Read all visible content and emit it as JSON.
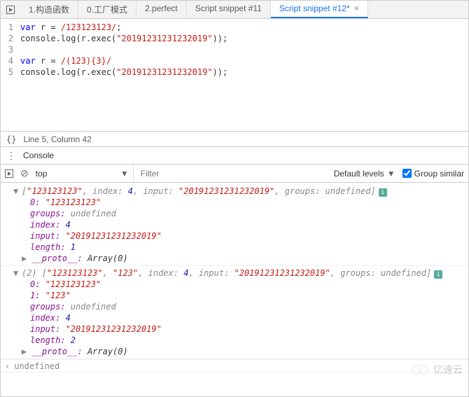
{
  "tabs": {
    "items": [
      "1.构造函数",
      "0.工厂模式",
      "2.perfect",
      "Script snippet #11",
      "Script snippet #12*"
    ],
    "active_index": 4,
    "close_glyph": "×"
  },
  "code": {
    "lines": [
      {
        "n": "1",
        "tokens": [
          {
            "t": "var ",
            "c": "kw"
          },
          {
            "t": "r = ",
            "c": "punc"
          },
          {
            "t": "/123123123/",
            "c": "regex"
          },
          {
            "t": ";",
            "c": "punc"
          }
        ]
      },
      {
        "n": "2",
        "tokens": [
          {
            "t": "console.log(r.exec(",
            "c": "punc"
          },
          {
            "t": "\"20191231231232019\"",
            "c": "str"
          },
          {
            "t": "));",
            "c": "punc"
          }
        ]
      },
      {
        "n": "3",
        "tokens": []
      },
      {
        "n": "4",
        "tokens": [
          {
            "t": "var ",
            "c": "kw"
          },
          {
            "t": "r = ",
            "c": "punc"
          },
          {
            "t": "/(123){3}/",
            "c": "regex"
          }
        ]
      },
      {
        "n": "5",
        "tokens": [
          {
            "t": "console.log(r.exec(",
            "c": "punc"
          },
          {
            "t": "\"20191231231232019\"",
            "c": "str"
          },
          {
            "t": "));",
            "c": "punc"
          }
        ]
      }
    ]
  },
  "status": {
    "braces": "{}",
    "cursor": "Line 5, Column 42"
  },
  "consoleTab": {
    "dots": "⋮",
    "label": "Console"
  },
  "toolbar": {
    "clear_glyph": "⊘",
    "context": "top",
    "filter_placeholder": "Filter",
    "levels_label": "Default levels",
    "group_similar": "Group similar"
  },
  "output": {
    "result1": {
      "summary_prefix": "[",
      "summary_items": [
        "\"123123123\"",
        "index: 4",
        "input: \"20191231231232019\"",
        "groups: undefined"
      ],
      "summary_suffix": "]",
      "props": [
        {
          "k": "0:",
          "v": "\"123123123\"",
          "vc": "v-str"
        },
        {
          "k": "groups:",
          "v": "undefined",
          "vc": "v-gray"
        },
        {
          "k": "index:",
          "v": "4",
          "vc": "k-blue"
        },
        {
          "k": "input:",
          "v": "\"20191231231232019\"",
          "vc": "v-str"
        },
        {
          "k": "length:",
          "v": "1",
          "vc": "k-blue"
        }
      ],
      "proto": "__proto__:",
      "proto_val": "Array(0)"
    },
    "result2": {
      "summary_pre": "(2) ",
      "summary_prefix": "[",
      "summary_items": [
        "\"123123123\"",
        "\"123\"",
        "index: 4",
        "input: \"20191231231232019\"",
        "groups: undefined"
      ],
      "summary_suffix": "]",
      "props": [
        {
          "k": "0:",
          "v": "\"123123123\"",
          "vc": "v-str"
        },
        {
          "k": "1:",
          "v": "\"123\"",
          "vc": "v-str"
        },
        {
          "k": "groups:",
          "v": "undefined",
          "vc": "v-gray"
        },
        {
          "k": "index:",
          "v": "4",
          "vc": "k-blue"
        },
        {
          "k": "input:",
          "v": "\"20191231231232019\"",
          "vc": "v-str"
        },
        {
          "k": "length:",
          "v": "2",
          "vc": "k-blue"
        }
      ],
      "proto": "__proto__:",
      "proto_val": "Array(0)"
    },
    "return_val": "undefined",
    "out_glyph": "‹",
    "in_glyph": "›"
  },
  "watermark": "亿速云"
}
